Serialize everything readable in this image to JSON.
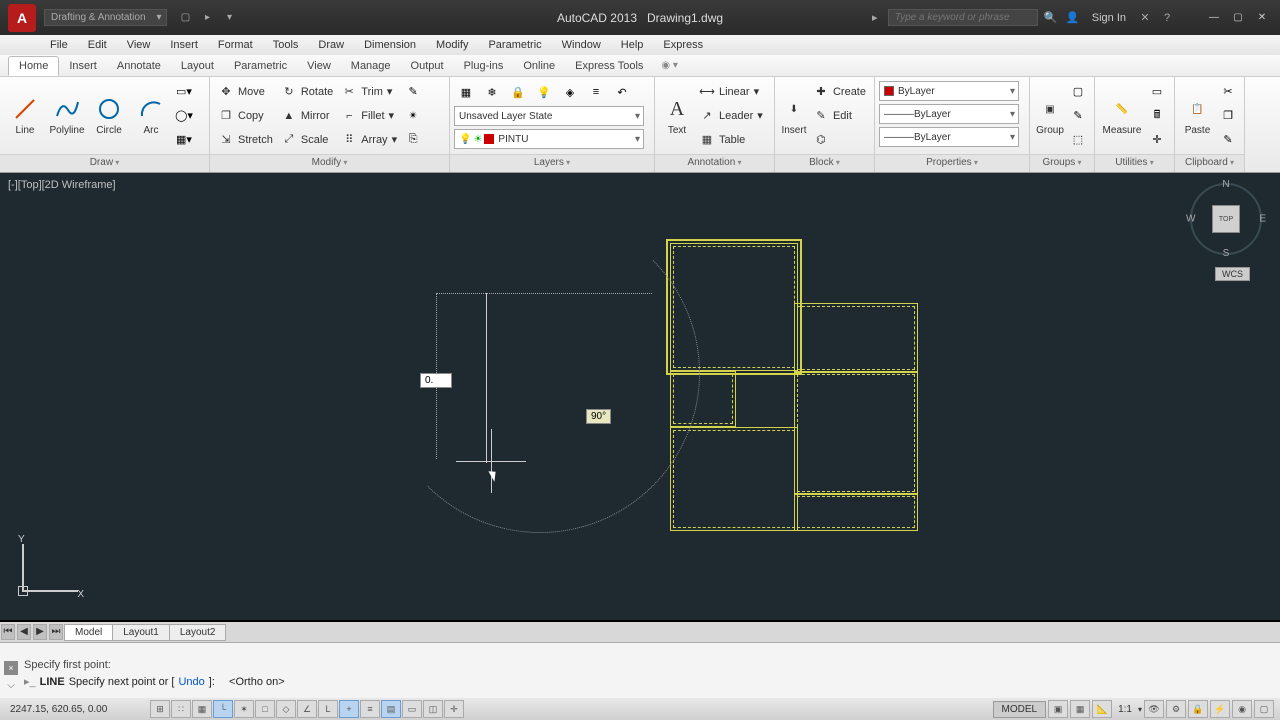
{
  "titlebar": {
    "workspace": "Drafting & Annotation",
    "app_title": "AutoCAD 2013",
    "file_name": "Drawing1.dwg",
    "search_placeholder": "Type a keyword or phrase",
    "signin": "Sign In"
  },
  "menubar": [
    "File",
    "Edit",
    "View",
    "Insert",
    "Format",
    "Tools",
    "Draw",
    "Dimension",
    "Modify",
    "Parametric",
    "Window",
    "Help",
    "Express"
  ],
  "ribbon_tabs": [
    "Home",
    "Insert",
    "Annotate",
    "Layout",
    "Parametric",
    "View",
    "Manage",
    "Output",
    "Plug-ins",
    "Online",
    "Express Tools"
  ],
  "active_tab": "Home",
  "panels": {
    "draw": {
      "title": "Draw",
      "line": "Line",
      "polyline": "Polyline",
      "circle": "Circle",
      "arc": "Arc"
    },
    "modify": {
      "title": "Modify",
      "move": "Move",
      "rotate": "Rotate",
      "trim": "Trim",
      "copy": "Copy",
      "mirror": "Mirror",
      "fillet": "Fillet",
      "stretch": "Stretch",
      "scale": "Scale",
      "array": "Array"
    },
    "layers": {
      "title": "Layers",
      "state": "Unsaved Layer State",
      "current": "PINTU"
    },
    "annotation": {
      "title": "Annotation",
      "text": "Text",
      "linear": "Linear",
      "leader": "Leader",
      "table": "Table"
    },
    "block": {
      "title": "Block",
      "insert": "Insert",
      "create": "Create",
      "edit": "Edit"
    },
    "properties": {
      "title": "Properties",
      "bylayer": "ByLayer"
    },
    "groups": {
      "title": "Groups",
      "group": "Group"
    },
    "utilities": {
      "title": "Utilities",
      "measure": "Measure"
    },
    "clipboard": {
      "title": "Clipboard",
      "paste": "Paste"
    }
  },
  "viewport": {
    "label": "[-][Top][2D Wireframe]",
    "cube_face": "TOP",
    "wcs": "WCS"
  },
  "dynamic": {
    "length_input": "0.",
    "angle_label": "90°"
  },
  "ucs": {
    "x": "X",
    "y": "Y"
  },
  "layout_tabs": {
    "model": "Model",
    "l1": "Layout1",
    "l2": "Layout2"
  },
  "command": {
    "history": "Specify first point:",
    "cmd": "LINE",
    "prompt_pre": "Specify next point or [",
    "undo": "Undo",
    "prompt_post": "]:",
    "ortho": "<Ortho on>"
  },
  "status": {
    "coords": "2247.15, 620.65, 0.00",
    "model": "MODEL",
    "scale": "1:1"
  }
}
